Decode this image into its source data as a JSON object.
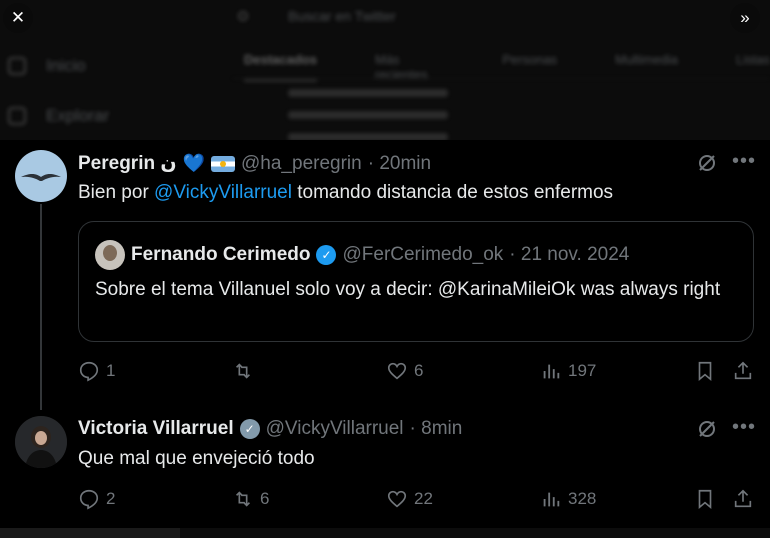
{
  "background": {
    "search_placeholder": "Buscar en Twitter",
    "nav": [
      {
        "label": "Inicio",
        "icon": "home-icon"
      },
      {
        "label": "Explorar",
        "icon": "search-icon"
      }
    ],
    "tabs": [
      "Destacados",
      "Más recientes",
      "Personas",
      "Multimedia",
      "Listas"
    ]
  },
  "controls": {
    "close_glyph": "✕",
    "expand_glyph": "»"
  },
  "tweets": [
    {
      "name": "Peregrin ن",
      "handle": "@ha_peregrin",
      "time": "· 20min",
      "text_before": "Bien por ",
      "mention": "@VickyVillarruel",
      "text_after": " tomando distancia de estos enfermos",
      "quote": {
        "name": "Fernando Cerimedo",
        "handle": "@FerCerimedo_ok",
        "time": "· 21 nov. 2024",
        "text": "Sobre el tema Villanuel solo voy a decir: @KarinaMileiOk  was always right"
      },
      "stats": {
        "replies": "1",
        "retweets": "",
        "likes": "6",
        "views": "197"
      }
    },
    {
      "name": "Victoria Villarruel",
      "handle": "@VickyVillarruel",
      "time": "· 8min",
      "text": "Que mal que envejeció todo",
      "stats": {
        "replies": "2",
        "retweets": "6",
        "likes": "22",
        "views": "328"
      }
    }
  ],
  "colors": {
    "accent": "#1d9bf0",
    "muted": "#71767b",
    "background": "#000000",
    "text": "#e7e9ea"
  }
}
